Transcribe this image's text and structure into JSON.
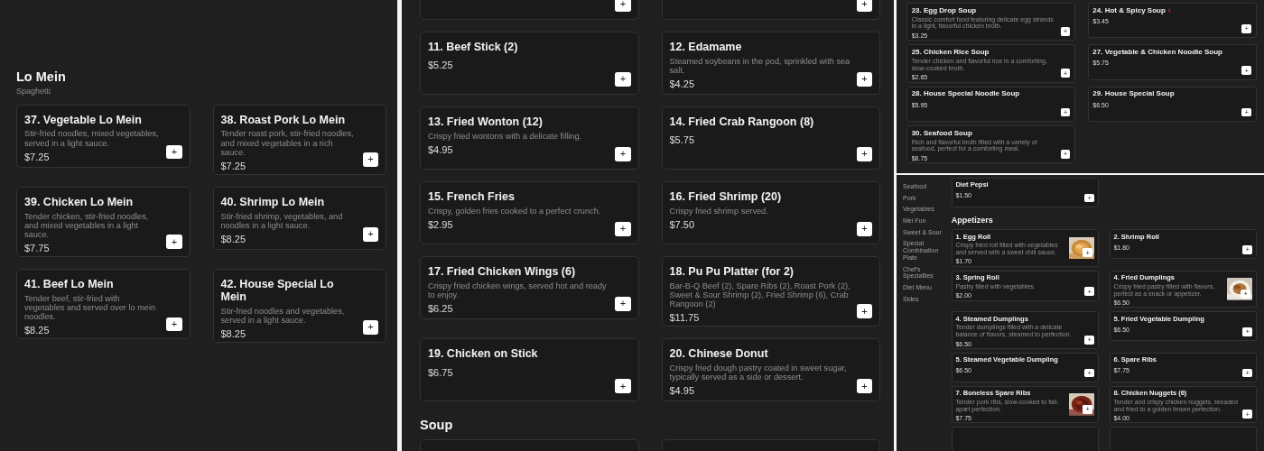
{
  "screens": [
    {
      "sections": [
        {
          "title": "Lo Mein",
          "subtitle": "Spaghetti",
          "items": [
            {
              "kind": "plain",
              "name": "37. Vegetable Lo Mein",
              "description": "Stir-fried noodles, mixed vegetables, served in a light sauce.",
              "price": "$7.25",
              "button": "+"
            },
            {
              "kind": "plain",
              "name": "38. Roast Pork Lo Mein",
              "description": "Tender roast pork, stir-fried noodles, and mixed vegetables in a rich sauce.",
              "price": "$7.25",
              "button": "+"
            },
            {
              "kind": "plain",
              "name": "39. Chicken Lo Mein",
              "description": "Tender chicken, stir-fried noodles, and mixed vegetables in a light sauce.",
              "price": "$7.75",
              "button": "+"
            },
            {
              "kind": "plain",
              "name": "40. Shrimp Lo Mein",
              "description": "Stir-fried shrimp, vegetables, and noodles in a light sauce.",
              "price": "$8.25",
              "button": "+"
            },
            {
              "kind": "plain",
              "name": "41. Beef Lo Mein",
              "description": "Tender beef, stir-fried with vegetables and served over lo mein noodles.",
              "price": "$8.25",
              "button": "+"
            },
            {
              "kind": "plain",
              "name": "42. House Special Lo Mein",
              "description": "Stir-fried noodles and vegetables, served in a light sauce.",
              "price": "$8.25",
              "button": "+"
            }
          ]
        }
      ]
    },
    {
      "sections": [
        {
          "items": [
            {
              "kind": "top_cut",
              "button": "+"
            },
            {
              "kind": "top_cut",
              "button": "+"
            }
          ]
        },
        {
          "items": [
            {
              "kind": "plain",
              "name": "11. Beef Stick (2)",
              "price": "$5.25",
              "button": "+"
            },
            {
              "kind": "plain",
              "name": "12. Edamame",
              "description": "Steamed soybeans in the pod, sprinkled with sea salt.",
              "price": "$4.25",
              "button": "+"
            },
            {
              "kind": "plain",
              "name": "13. Fried Wonton (12)",
              "description": "Crispy fried wontons with a delicate filling.",
              "price": "$4.95",
              "button": "+"
            },
            {
              "kind": "plain",
              "name": "14. Fried Crab Rangoon (8)",
              "price": "$5.75",
              "button": "+"
            },
            {
              "kind": "plain",
              "name": "15. French Fries",
              "description": "Crispy, golden fries cooked to a perfect crunch.",
              "price": "$2.95",
              "button": "+"
            },
            {
              "kind": "plain",
              "name": "16. Fried Shrimp (20)",
              "description": "Crispy fried shrimp served.",
              "price": "$7.50",
              "button": "+"
            },
            {
              "kind": "plain",
              "name": "17. Fried Chicken Wings (6)",
              "description": "Crispy fried chicken wings, served hot and ready to enjoy.",
              "price": "$6.25",
              "button": "+"
            },
            {
              "kind": "plain",
              "name": "18. Pu Pu Platter (for 2)",
              "description": "Bar-B-Q Beef (2), Spare Ribs (2), Roast Pork (2), Sweet & Sour Shrimp (2), Fried Shrimp (6), Crab Rangoon (2)",
              "price": "$11.75",
              "button": "+"
            },
            {
              "kind": "plain",
              "name": "19. Chicken on Stick",
              "price": "$6.75",
              "button": "+"
            },
            {
              "kind": "plain",
              "name": "20. Chinese Donut",
              "description": "Crispy fried dough pastry coated in sweet sugar, typically served as a side or dessert.",
              "price": "$4.95",
              "button": "+"
            }
          ]
        },
        {
          "title": "Soup",
          "items": [
            {
              "kind": "bottom_cut"
            },
            {
              "kind": "bottom_cut"
            }
          ]
        }
      ]
    },
    {
      "sections": [
        {
          "items": [
            {
              "kind": "plain",
              "name": "23. Egg Drop Soup",
              "description": "Classic comfort food featuring delicate egg strands in a light, flavorful chicken broth.",
              "price": "$3.25",
              "button": "+",
              "spicy": false
            },
            {
              "kind": "plain",
              "name": "24. Hot & Spicy Soup",
              "price": "$3.45",
              "button": "+",
              "spicy": true
            },
            {
              "kind": "plain",
              "name": "25. Chicken Rice Soup",
              "description": "Tender chicken and flavorful rice in a comforting, slow-cooked broth.",
              "price": "$2.65",
              "button": "+",
              "spicy": false
            },
            {
              "kind": "plain",
              "name": "27. Vegetable & Chicken Noodle Soup",
              "price": "$5.75",
              "button": "+",
              "spicy": false
            },
            {
              "kind": "plain",
              "name": "28. House Special Noodle Soup",
              "price": "$5.95",
              "button": "+",
              "spicy": false
            },
            {
              "kind": "plain",
              "name": "29. House Special Soup",
              "price": "$6.50",
              "button": "+",
              "spicy": false
            },
            {
              "kind": "plain",
              "name": "30. Seafood Soup",
              "description": "Rich and flavorful broth filled with a variety of seafood, perfect for a comforting meal.",
              "price": "$6.75",
              "button": "+",
              "spicy": false
            }
          ]
        }
      ]
    },
    {
      "sidebar": {
        "items": [
          "Seafood",
          "Pork",
          "Vegetables",
          "Mei Fun",
          "Sweet & Sour",
          "Special Combination Plate",
          "Chef's Specialties",
          "Diet Menu",
          "Sides"
        ]
      },
      "sections": [
        {
          "items": [
            {
              "kind": "plain",
              "name": "Diet Pepsi",
              "price": "$1.50",
              "button": "+"
            }
          ]
        },
        {
          "title": "Appetizers",
          "items": [
            {
              "name": "1. Egg Roll",
              "description": "Crispy fried roll filled with vegetables and served with a sweet chili sauce.",
              "price": "$1.70",
              "button": "+"
            },
            {
              "kind": "plain",
              "name": "2. Shrimp Roll",
              "price": "$1.80",
              "button": "+"
            },
            {
              "kind": "plain",
              "name": "3. Spring Roll",
              "description": "Pastry filled with vegetables.",
              "price": "$2.00",
              "button": "+"
            },
            {
              "name": "4. Fried Dumplings",
              "description": "Crispy fried pastry filled with flavors, perfect as a snack or appetizer.",
              "price": "$6.50",
              "button": "+"
            },
            {
              "kind": "plain",
              "name": "4. Steamed Dumplings",
              "description": "Tender dumplings filled with a delicate balance of flavors, steamed to perfection.",
              "price": "$6.50",
              "button": "+"
            },
            {
              "kind": "plain",
              "name": "5. Fried Vegetable Dumpling",
              "price": "$6.50",
              "button": "+"
            },
            {
              "kind": "plain",
              "name": "5. Steamed Vegetable Dumpling",
              "price": "$6.50",
              "button": "+"
            },
            {
              "kind": "plain",
              "name": "6. Spare Ribs",
              "price": "$7.75",
              "button": "+"
            },
            {
              "name": "7. Boneless Spare Ribs",
              "description": "Tender pork ribs, slow-cooked to fall-apart perfection.",
              "price": "$7.75",
              "button": "+"
            },
            {
              "kind": "plain",
              "name": "8. Chicken Nuggets (6)",
              "description": "Tender and crispy chicken nuggets, breaded and fried to a golden brown perfection.",
              "price": "$4.00",
              "button": "+"
            },
            {
              "kind": "bottom_cut"
            },
            {
              "kind": "bottom_cut"
            }
          ]
        }
      ]
    }
  ]
}
